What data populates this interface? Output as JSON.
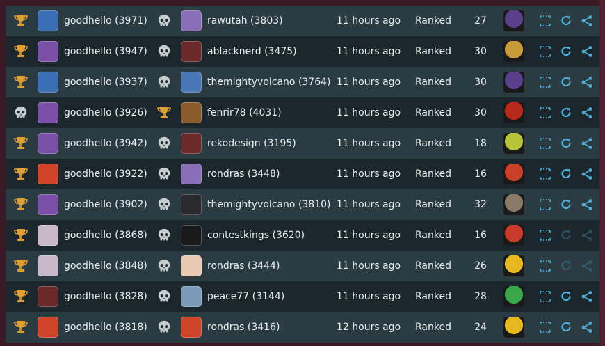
{
  "colors": {
    "accent_blue": "#4fb3d9",
    "trophy_gold": "#e0a030",
    "skull": "#c8cdd0"
  },
  "rows": [
    {
      "result": "win",
      "p1_name": "goodhello (3971)",
      "p1_avatar": "#3b6fb5",
      "opp_result": "loss",
      "p2_name": "rawutah (3803)",
      "p2_avatar": "#8a6fb8",
      "time": "11 hours ago",
      "mode": "Ranked",
      "turns": "27",
      "hero": "#5a3f8a",
      "replay_enabled": true
    },
    {
      "result": "win",
      "p1_name": "goodhello (3947)",
      "p1_avatar": "#7a4fa8",
      "opp_result": "loss",
      "p2_name": "ablacknerd (3475)",
      "p2_avatar": "#6a2a2a",
      "time": "11 hours ago",
      "mode": "Ranked",
      "turns": "30",
      "hero": "#c79a3a",
      "replay_enabled": true
    },
    {
      "result": "win",
      "p1_name": "goodhello (3937)",
      "p1_avatar": "#3b6fb5",
      "opp_result": "loss",
      "p2_name": "themightyvolcano (3764)",
      "p2_avatar": "#4a76b8",
      "time": "11 hours ago",
      "mode": "Ranked",
      "turns": "30",
      "hero": "#5a3f8a",
      "replay_enabled": true
    },
    {
      "result": "loss",
      "p1_name": "goodhello (3926)",
      "p1_avatar": "#7a4fa8",
      "opp_result": "win",
      "p2_name": "fenrir78 (4031)",
      "p2_avatar": "#8a5a2a",
      "time": "11 hours ago",
      "mode": "Ranked",
      "turns": "30",
      "hero": "#b52a1a",
      "replay_enabled": true
    },
    {
      "result": "win",
      "p1_name": "goodhello (3942)",
      "p1_avatar": "#7a4fa8",
      "opp_result": "loss",
      "p2_name": "rekodesign (3195)",
      "p2_avatar": "#6a2a2a",
      "time": "11 hours ago",
      "mode": "Ranked",
      "turns": "18",
      "hero": "#b7c43a",
      "replay_enabled": true
    },
    {
      "result": "win",
      "p1_name": "goodhello (3922)",
      "p1_avatar": "#d0452a",
      "opp_result": "loss",
      "p2_name": "rondras (3448)",
      "p2_avatar": "#8a6fb8",
      "time": "11 hours ago",
      "mode": "Ranked",
      "turns": "16",
      "hero": "#c8402a",
      "replay_enabled": true
    },
    {
      "result": "win",
      "p1_name": "goodhello (3902)",
      "p1_avatar": "#7a4fa8",
      "opp_result": "loss",
      "p2_name": "themightyvolcano (3810)",
      "p2_avatar": "#2a2a2e",
      "time": "11 hours ago",
      "mode": "Ranked",
      "turns": "32",
      "hero": "#8a7a6a",
      "replay_enabled": true
    },
    {
      "result": "win",
      "p1_name": "goodhello (3868)",
      "p1_avatar": "#c8b8c8",
      "opp_result": "loss",
      "p2_name": "contestkings (3620)",
      "p2_avatar": "#1a1a1a",
      "time": "11 hours ago",
      "mode": "Ranked",
      "turns": "16",
      "hero": "#c83a2a",
      "replay_enabled": false
    },
    {
      "result": "win",
      "p1_name": "goodhello (3848)",
      "p1_avatar": "#c8b8c8",
      "opp_result": "loss",
      "p2_name": "rondras (3444)",
      "p2_avatar": "#e8c8b0",
      "time": "11 hours ago",
      "mode": "Ranked",
      "turns": "26",
      "hero": "#e8b820",
      "replay_enabled": false
    },
    {
      "result": "win",
      "p1_name": "goodhello (3828)",
      "p1_avatar": "#6a2a2a",
      "opp_result": "loss",
      "p2_name": "peace77 (3144)",
      "p2_avatar": "#7a9ab8",
      "time": "11 hours ago",
      "mode": "Ranked",
      "turns": "28",
      "hero": "#3aa84a",
      "replay_enabled": true
    },
    {
      "result": "win",
      "p1_name": "goodhello (3818)",
      "p1_avatar": "#d0452a",
      "opp_result": "loss",
      "p2_name": "rondras (3416)",
      "p2_avatar": "#d0452a",
      "time": "12 hours ago",
      "mode": "Ranked",
      "turns": "24",
      "hero": "#e8b820",
      "replay_enabled": true
    }
  ]
}
